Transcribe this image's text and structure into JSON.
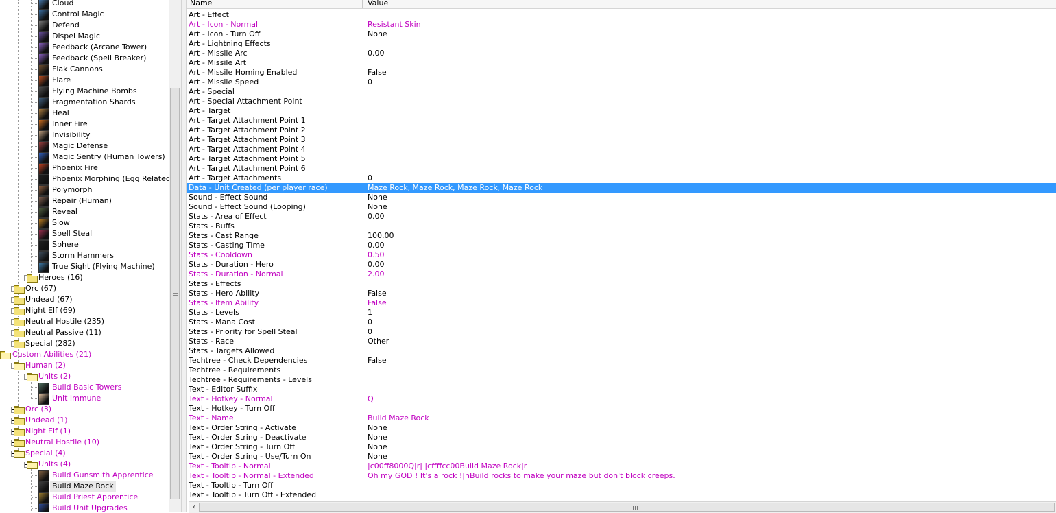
{
  "tree": {
    "items": [
      {
        "label": "Cloud",
        "kind": "ability",
        "depth": 3,
        "icon": "cloud-icon",
        "color": "#4a7fb5"
      },
      {
        "label": "Control Magic",
        "kind": "ability",
        "depth": 3,
        "icon": "control-magic-icon",
        "color": "#3a6ea0"
      },
      {
        "label": "Defend",
        "kind": "ability",
        "depth": 3,
        "icon": "defend-icon",
        "color": "#7a7a7a"
      },
      {
        "label": "Dispel Magic",
        "kind": "ability",
        "depth": 3,
        "icon": "dispel-magic-icon",
        "color": "#6a50a0"
      },
      {
        "label": "Feedback (Arcane Tower)",
        "kind": "ability",
        "depth": 3,
        "icon": "feedback-icon",
        "color": "#8a60c0"
      },
      {
        "label": "Feedback (Spell Breaker)",
        "kind": "ability",
        "depth": 3,
        "icon": "feedback-icon",
        "color": "#8a60c0"
      },
      {
        "label": "Flak Cannons",
        "kind": "ability",
        "depth": 3,
        "icon": "flak-cannons-icon",
        "color": "#705030"
      },
      {
        "label": "Flare",
        "kind": "ability",
        "depth": 3,
        "icon": "flare-icon",
        "color": "#c05020"
      },
      {
        "label": "Flying Machine Bombs",
        "kind": "ability",
        "depth": 3,
        "icon": "flying-machine-bombs-icon",
        "color": "#505050"
      },
      {
        "label": "Fragmentation Shards",
        "kind": "ability",
        "depth": 3,
        "icon": "fragmentation-shards-icon",
        "color": "#406080"
      },
      {
        "label": "Heal",
        "kind": "ability",
        "depth": 3,
        "icon": "heal-icon",
        "color": "#b08040"
      },
      {
        "label": "Inner Fire",
        "kind": "ability",
        "depth": 3,
        "icon": "inner-fire-icon",
        "color": "#d07020"
      },
      {
        "label": "Invisibility",
        "kind": "ability",
        "depth": 3,
        "icon": "invisibility-icon",
        "color": "#c0a080"
      },
      {
        "label": "Magic Defense",
        "kind": "ability",
        "depth": 3,
        "icon": "magic-defense-icon",
        "color": "#a04040"
      },
      {
        "label": "Magic Sentry (Human Towers)",
        "kind": "ability",
        "depth": 3,
        "icon": "magic-sentry-icon",
        "color": "#3060c0"
      },
      {
        "label": "Phoenix Fire",
        "kind": "ability",
        "depth": 3,
        "icon": "phoenix-fire-icon",
        "color": "#c04020"
      },
      {
        "label": "Phoenix Morphing (Egg Related)",
        "kind": "ability",
        "depth": 3,
        "icon": "morph-icon",
        "color": "#202020"
      },
      {
        "label": "Polymorph",
        "kind": "ability",
        "depth": 3,
        "icon": "polymorph-icon",
        "color": "#906040"
      },
      {
        "label": "Repair (Human)",
        "kind": "ability",
        "depth": 3,
        "icon": "repair-icon",
        "color": "#806050"
      },
      {
        "label": "Reveal",
        "kind": "ability",
        "depth": 3,
        "icon": "reveal-icon",
        "color": "#506040"
      },
      {
        "label": "Slow",
        "kind": "ability",
        "depth": 3,
        "icon": "slow-icon",
        "color": "#c08020"
      },
      {
        "label": "Spell Steal",
        "kind": "ability",
        "depth": 3,
        "icon": "spell-steal-icon",
        "color": "#a03050"
      },
      {
        "label": "Sphere",
        "kind": "ability",
        "depth": 3,
        "icon": "sphere-icon",
        "color": "#202020"
      },
      {
        "label": "Storm Hammers",
        "kind": "ability",
        "depth": 3,
        "icon": "storm-hammers-icon",
        "color": "#405060"
      },
      {
        "label": "True Sight (Flying Machine)",
        "kind": "ability",
        "depth": 3,
        "icon": "true-sight-icon",
        "color": "#4080b0"
      },
      {
        "label": "Heroes (16)",
        "kind": "folder",
        "depth": 2,
        "expander": "plus"
      },
      {
        "label": "Orc (67)",
        "kind": "folder",
        "depth": 1,
        "expander": "plus"
      },
      {
        "label": "Undead (67)",
        "kind": "folder",
        "depth": 1,
        "expander": "plus"
      },
      {
        "label": "Night Elf (69)",
        "kind": "folder",
        "depth": 1,
        "expander": "plus"
      },
      {
        "label": "Neutral Hostile (235)",
        "kind": "folder",
        "depth": 1,
        "expander": "plus"
      },
      {
        "label": "Neutral Passive (11)",
        "kind": "folder",
        "depth": 1,
        "expander": "plus"
      },
      {
        "label": "Special (282)",
        "kind": "folder",
        "depth": 1,
        "expander": "plus"
      },
      {
        "label": "Custom Abilities (21)",
        "kind": "folder",
        "depth": 0,
        "custom": true,
        "open": true
      },
      {
        "label": "Human (2)",
        "kind": "folder",
        "depth": 1,
        "expander": "minus",
        "custom": true,
        "open": true
      },
      {
        "label": "Units (2)",
        "kind": "folder",
        "depth": 2,
        "expander": "minus",
        "custom": true,
        "open": true
      },
      {
        "label": "Build Basic Towers",
        "kind": "ability",
        "depth": 3,
        "custom": true,
        "icon": "build-icon",
        "color": "#507060"
      },
      {
        "label": "Unit Immune",
        "kind": "ability",
        "depth": 3,
        "custom": true,
        "icon": "unit-immune-icon",
        "color": "#e0c0a0"
      },
      {
        "label": "Orc (3)",
        "kind": "folder",
        "depth": 1,
        "expander": "plus",
        "custom": true
      },
      {
        "label": "Undead (1)",
        "kind": "folder",
        "depth": 1,
        "expander": "plus",
        "custom": true
      },
      {
        "label": "Night Elf (1)",
        "kind": "folder",
        "depth": 1,
        "expander": "plus",
        "custom": true
      },
      {
        "label": "Neutral Hostile (10)",
        "kind": "folder",
        "depth": 1,
        "expander": "plus",
        "custom": true
      },
      {
        "label": "Special (4)",
        "kind": "folder",
        "depth": 1,
        "expander": "minus",
        "custom": true,
        "open": true
      },
      {
        "label": "Units (4)",
        "kind": "folder",
        "depth": 2,
        "expander": "minus",
        "custom": true,
        "open": true
      },
      {
        "label": "Build Gunsmith Apprentice",
        "kind": "ability",
        "depth": 3,
        "custom": true,
        "icon": "build-icon",
        "color": "#806040"
      },
      {
        "label": "Build Maze Rock",
        "kind": "ability",
        "depth": 3,
        "selected": true,
        "icon": "build-icon",
        "color": "#404040"
      },
      {
        "label": "Build Priest Apprentice",
        "kind": "ability",
        "depth": 3,
        "custom": true,
        "icon": "build-icon",
        "color": "#a08030"
      },
      {
        "label": "Build Unit Upgrades",
        "kind": "ability",
        "depth": 3,
        "custom": true,
        "icon": "build-icon",
        "color": "#3050a0"
      }
    ]
  },
  "grid": {
    "headers": {
      "name": "Name",
      "value": "Value"
    },
    "rows": [
      {
        "name": "Art - Effect",
        "value": ""
      },
      {
        "name": "Art - Icon - Normal",
        "value": "Resistant Skin",
        "modified": true
      },
      {
        "name": "Art - Icon - Turn Off",
        "value": "None"
      },
      {
        "name": "Art - Lightning Effects",
        "value": ""
      },
      {
        "name": "Art - Missile Arc",
        "value": "0.00"
      },
      {
        "name": "Art - Missile Art",
        "value": ""
      },
      {
        "name": "Art - Missile Homing Enabled",
        "value": "False"
      },
      {
        "name": "Art - Missile Speed",
        "value": "0"
      },
      {
        "name": "Art - Special",
        "value": ""
      },
      {
        "name": "Art - Special Attachment Point",
        "value": ""
      },
      {
        "name": "Art - Target",
        "value": ""
      },
      {
        "name": "Art - Target Attachment Point 1",
        "value": ""
      },
      {
        "name": "Art - Target Attachment Point 2",
        "value": ""
      },
      {
        "name": "Art - Target Attachment Point 3",
        "value": ""
      },
      {
        "name": "Art - Target Attachment Point 4",
        "value": ""
      },
      {
        "name": "Art - Target Attachment Point 5",
        "value": ""
      },
      {
        "name": "Art - Target Attachment Point 6",
        "value": ""
      },
      {
        "name": "Art - Target Attachments",
        "value": "0"
      },
      {
        "name": "Data - Unit Created (per player race)",
        "value": "Maze Rock, Maze Rock, Maze Rock, Maze Rock",
        "selected": true
      },
      {
        "name": "Sound - Effect Sound",
        "value": "None"
      },
      {
        "name": "Sound - Effect Sound (Looping)",
        "value": "None"
      },
      {
        "name": "Stats - Area of Effect",
        "value": "0.00"
      },
      {
        "name": "Stats - Buffs",
        "value": ""
      },
      {
        "name": "Stats - Cast Range",
        "value": "100.00"
      },
      {
        "name": "Stats - Casting Time",
        "value": "0.00"
      },
      {
        "name": "Stats - Cooldown",
        "value": "0.50",
        "modified": true
      },
      {
        "name": "Stats - Duration - Hero",
        "value": "0.00"
      },
      {
        "name": "Stats - Duration - Normal",
        "value": "2.00",
        "modified": true
      },
      {
        "name": "Stats - Effects",
        "value": ""
      },
      {
        "name": "Stats - Hero Ability",
        "value": "False"
      },
      {
        "name": "Stats - Item Ability",
        "value": "False",
        "modified": true
      },
      {
        "name": "Stats - Levels",
        "value": "1"
      },
      {
        "name": "Stats - Mana Cost",
        "value": "0"
      },
      {
        "name": "Stats - Priority for Spell Steal",
        "value": "0"
      },
      {
        "name": "Stats - Race",
        "value": "Other"
      },
      {
        "name": "Stats - Targets Allowed",
        "value": ""
      },
      {
        "name": "Techtree - Check Dependencies",
        "value": "False"
      },
      {
        "name": "Techtree - Requirements",
        "value": ""
      },
      {
        "name": "Techtree - Requirements - Levels",
        "value": ""
      },
      {
        "name": "Text - Editor Suffix",
        "value": ""
      },
      {
        "name": "Text - Hotkey - Normal",
        "value": "Q",
        "modified": true
      },
      {
        "name": "Text - Hotkey - Turn Off",
        "value": ""
      },
      {
        "name": "Text - Name",
        "value": "Build Maze Rock",
        "modified": true
      },
      {
        "name": "Text - Order String - Activate",
        "value": "None"
      },
      {
        "name": "Text - Order String - Deactivate",
        "value": "None"
      },
      {
        "name": "Text - Order String - Turn Off",
        "value": "None"
      },
      {
        "name": "Text - Order String - Use/Turn On",
        "value": "None"
      },
      {
        "name": "Text - Tooltip - Normal",
        "value": "|c00ff8000Q|r| |cffffcc00Build Maze Rock|r",
        "modified": true
      },
      {
        "name": "Text - Tooltip - Normal - Extended",
        "value": "Oh my GOD ! It's a rock !|nBuild rocks to make your maze but don't block creeps.",
        "modified": true
      },
      {
        "name": "Text - Tooltip - Turn Off",
        "value": ""
      },
      {
        "name": "Text - Tooltip - Turn Off - Extended",
        "value": ""
      }
    ]
  },
  "scrollbars": {
    "horizontal": {
      "left_arrow": "‹"
    }
  }
}
